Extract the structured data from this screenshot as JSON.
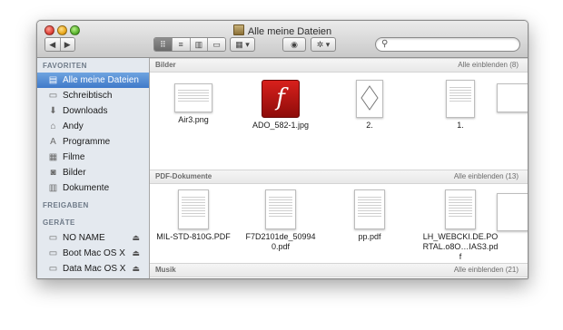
{
  "window": {
    "title": "Alle meine Dateien"
  },
  "toolbar": {
    "back_label": "◀",
    "forward_label": "▶",
    "view_modes": [
      "⠿",
      "≡",
      "▥",
      "▭"
    ],
    "arrange_label": "▦ ▾",
    "quicklook_label": "◉",
    "action_label": "✲ ▾",
    "search_placeholder": ""
  },
  "sidebar": {
    "favorites_heading": "FAVORITEN",
    "favorites": [
      {
        "label": "Alle meine Dateien",
        "icon": "all-files-icon",
        "glyph": "▤"
      },
      {
        "label": "Schreibtisch",
        "icon": "desktop-icon",
        "glyph": "▭"
      },
      {
        "label": "Downloads",
        "icon": "downloads-icon",
        "glyph": "⬇"
      },
      {
        "label": "Andy",
        "icon": "home-icon",
        "glyph": "⌂"
      },
      {
        "label": "Programme",
        "icon": "applications-icon",
        "glyph": "A"
      },
      {
        "label": "Filme",
        "icon": "movies-icon",
        "glyph": "▦"
      },
      {
        "label": "Bilder",
        "icon": "pictures-icon",
        "glyph": "◙"
      },
      {
        "label": "Dokumente",
        "icon": "documents-icon",
        "glyph": "▥"
      }
    ],
    "shared_heading": "FREIGABEN",
    "devices_heading": "GERÄTE",
    "devices": [
      {
        "label": "NO NAME",
        "icon": "drive-icon",
        "eject": "⏏"
      },
      {
        "label": "Boot Mac OS X",
        "icon": "drive-icon",
        "eject": "⏏"
      },
      {
        "label": "Data Mac OS X",
        "icon": "drive-icon",
        "eject": "⏏"
      }
    ]
  },
  "sections": {
    "images": {
      "title": "Bilder",
      "more": "Alle einblenden (8)",
      "files": [
        "Air3.png",
        "ADO_582-1.jpg",
        "2.",
        "1."
      ]
    },
    "pdfs": {
      "title": "PDF-Dokumente",
      "more": "Alle einblenden (13)",
      "files": [
        "MIL-STD-810G.PDF",
        "F7D2101de_509940.pdf",
        "pp.pdf",
        "LH_WEBCKI.DE.PORTAL.o8O…IAS3.pdf"
      ]
    },
    "music": {
      "title": "Musik",
      "more": "Alle einblenden (21)"
    }
  }
}
